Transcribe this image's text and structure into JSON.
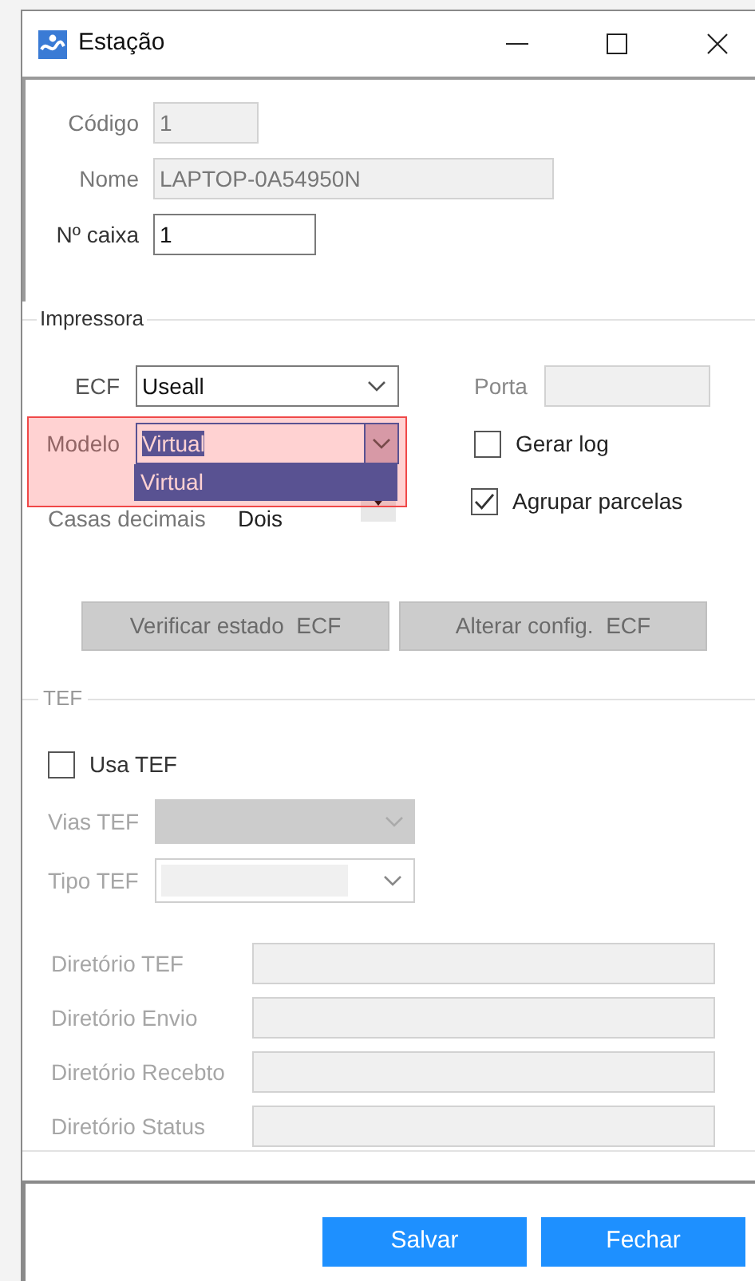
{
  "window": {
    "title": "Estação"
  },
  "general": {
    "fields": [
      {
        "label": "Código",
        "value": "1",
        "disabled": true
      },
      {
        "label": "Nome",
        "value": "LAPTOP-0A54950N",
        "disabled": true
      },
      {
        "label": "Nº caixa",
        "value": "1",
        "disabled": false
      }
    ]
  },
  "printer": {
    "title": "Impressora",
    "ecf": {
      "label": "ECF",
      "value": "Useall"
    },
    "port": {
      "label": "Porta",
      "disabled": true
    },
    "model": {
      "label": "Modelo",
      "value": "Virtual",
      "expanded": true,
      "options": [
        {
          "label": "Virtual",
          "selected": true
        }
      ]
    },
    "decimals": {
      "label": "Casas decimais",
      "value": "Dois"
    },
    "checkboxes": [
      {
        "label": "Gerar log",
        "checked": false
      },
      {
        "label": "Agrupar parcelas",
        "checked": true
      }
    ],
    "buttons": [
      "Verificar estado  ECF",
      "Alterar config.  ECF"
    ]
  },
  "tef": {
    "title": "TEF",
    "use_tef": {
      "label": "Usa TEF",
      "checked": false
    },
    "selects": [
      {
        "label": "Vias TEF",
        "disabled": true
      },
      {
        "label": "Tipo TEF",
        "disabled": false
      }
    ],
    "directories": [
      {
        "label": "Diretório TEF"
      },
      {
        "label": "Diretório Envio"
      },
      {
        "label": "Diretório Recebto"
      },
      {
        "label": "Diretório Status"
      }
    ]
  },
  "buttons": [
    "Salvar",
    "Fechar"
  ]
}
